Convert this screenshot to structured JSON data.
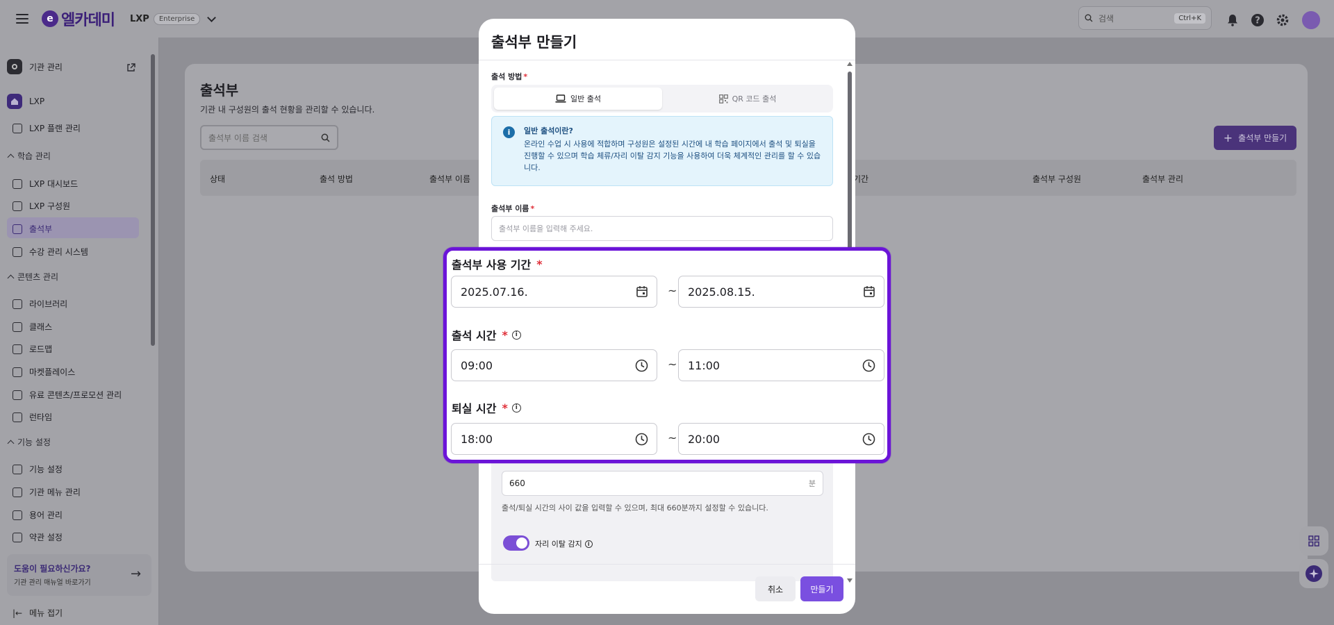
{
  "topbar": {
    "brand": "엘카데미",
    "product": "LXP",
    "edition": "Enterprise",
    "search_placeholder": "검색",
    "search_shortcut": "Ctrl+K"
  },
  "sidebar": {
    "org_admin": "기관 관리",
    "lxp": "LXP",
    "plan": "LXP 플랜 관리",
    "learning_header": "학습 관리",
    "learning_items": [
      "LXP 대시보드",
      "LXP 구성원",
      "출석부",
      "수강 관리 시스템"
    ],
    "content_header": "콘텐츠 관리",
    "content_items": [
      "라이브러리",
      "클래스",
      "로드맵",
      "마켓플레이스",
      "유료 콘텐츠/프로모션 관리",
      "런타임"
    ],
    "feature_header": "기능 설정",
    "feature_items": [
      "기능 설정",
      "기관 메뉴 관리",
      "용어 관리",
      "약관 설정"
    ],
    "help_title": "도움이 필요하신가요?",
    "help_sub": "기관 관리 매뉴얼 바로가기",
    "collapse": "메뉴 접기"
  },
  "main": {
    "title": "출석부",
    "description": "기관 내 구성원의 출석 현황을 관리할 수 있습니다.",
    "search_placeholder": "출석부 이름 검색",
    "create_button": "출석부 만들기",
    "columns": [
      "상태",
      "출석 방법",
      "출석부 이름",
      "기간",
      "출석부 구성원",
      "출석부 관리"
    ]
  },
  "modal": {
    "title": "출석부 만들기",
    "method_label": "출석 방법",
    "method_tabs": [
      "일반 출석",
      "QR 코드 출석"
    ],
    "info_title": "일반 출석이란?",
    "info_body": "온라인 수업 시 사용에 적합하며 구성원은 설정된 시간에 내 학습 페이지에서 출석 및 퇴실을 진행할 수 있으며 학습 체류/자리 이탈 감지 기능을 사용하여 더욱 체계적인 관리를 할 수 있습니다.",
    "name_label": "출석부 이름",
    "name_placeholder": "출석부 이름을 입력해 주세요.",
    "period_label": "출석부 사용 기간",
    "period_start": "2025.07.16.",
    "period_end": "2025.08.15.",
    "checkin_label": "출석 시간",
    "checkin_start": "09:00",
    "checkin_end": "11:00",
    "checkout_label": "퇴실 시간",
    "checkout_start": "18:00",
    "checkout_end": "20:00",
    "tilde": "~",
    "required_mark": "*",
    "minutes_value": "660",
    "minutes_unit": "분",
    "minutes_help": "출석/퇴실 시간의 사이 값을 입력할 수 있으며, 최대 660분까지 설정할 수 있습니다.",
    "away_detect_label": "자리 이탈 감지",
    "cancel": "취소",
    "create": "만들기"
  },
  "colors": {
    "accent": "#7a4fe0",
    "highlight_border": "#6b14d8",
    "info_bg": "#e4f4fc"
  }
}
